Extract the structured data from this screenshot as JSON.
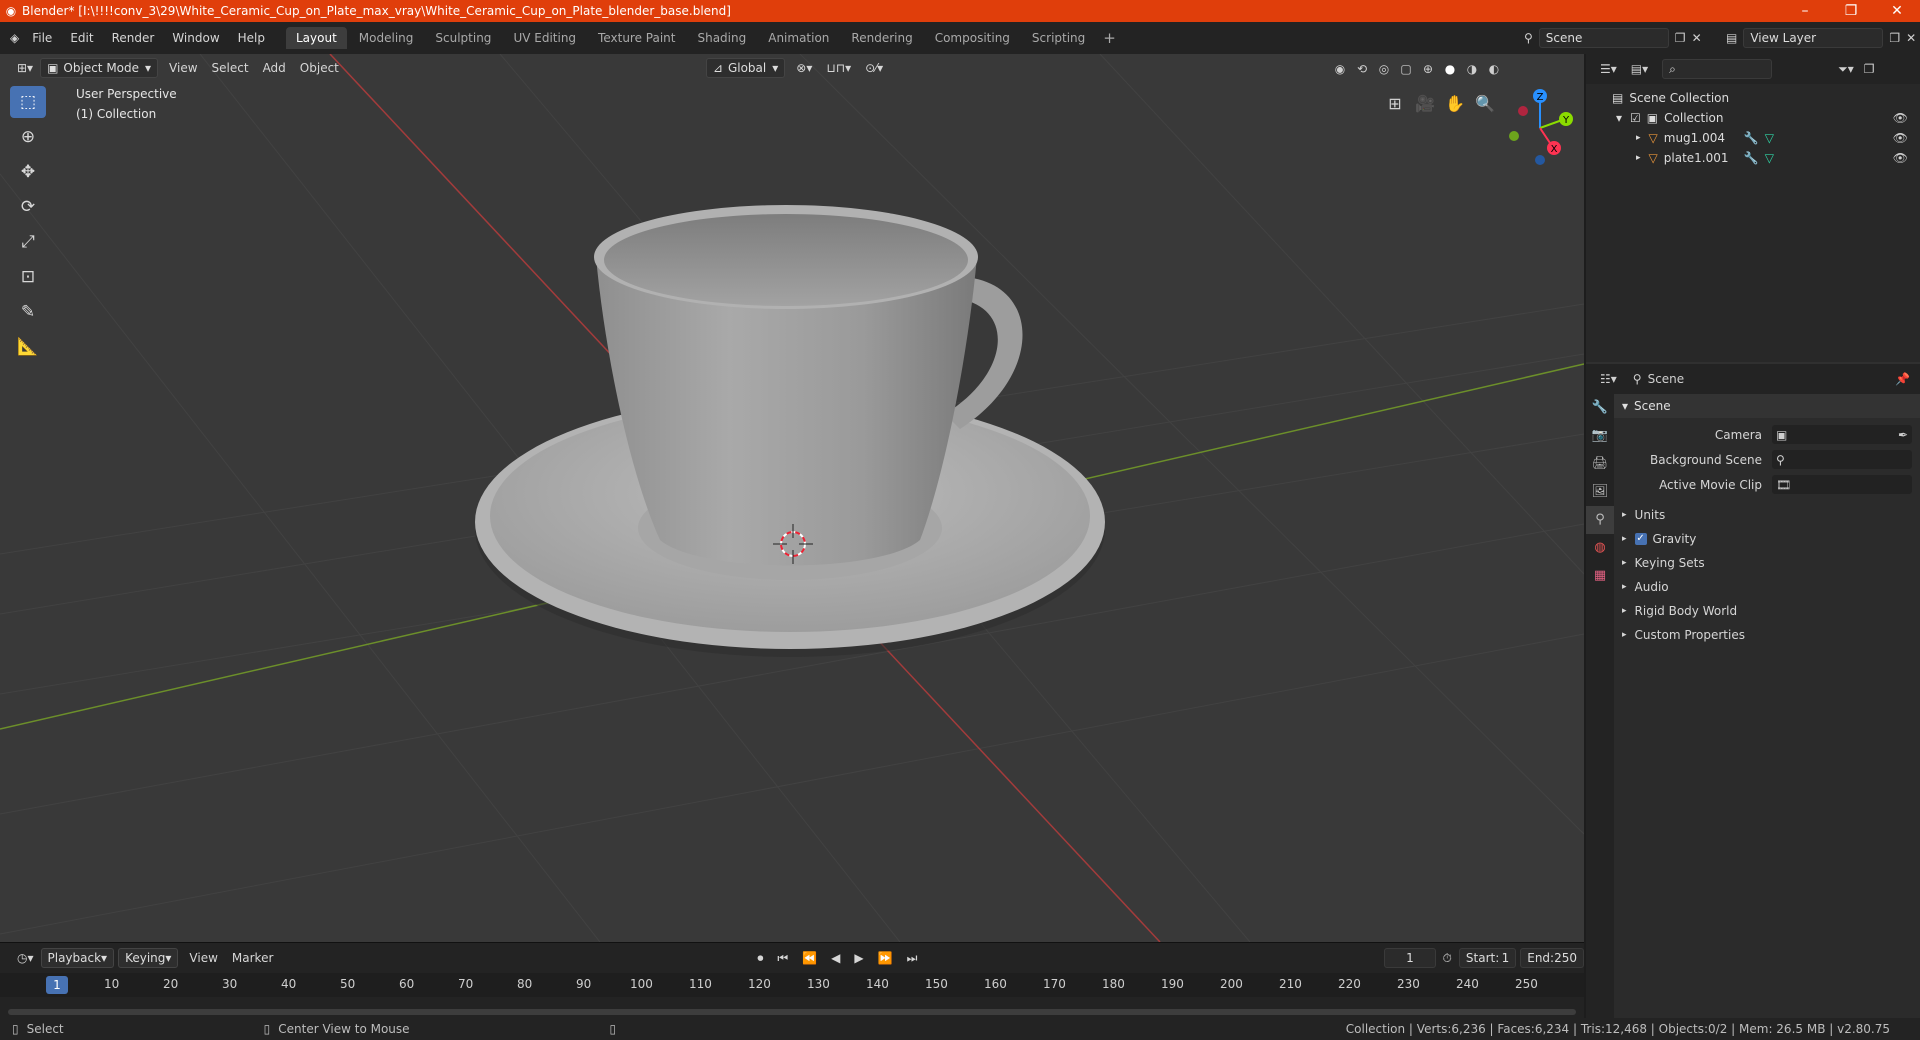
{
  "title": "Blender* [I:\\!!!!conv_3\\29\\White_Ceramic_Cup_on_Plate_max_vray\\White_Ceramic_Cup_on_Plate_blender_base.blend]",
  "menu": [
    "File",
    "Edit",
    "Render",
    "Window",
    "Help"
  ],
  "workspaces": [
    "Layout",
    "Modeling",
    "Sculpting",
    "UV Editing",
    "Texture Paint",
    "Shading",
    "Animation",
    "Rendering",
    "Compositing",
    "Scripting"
  ],
  "active_workspace": "Layout",
  "scene": "Scene",
  "view_layer": "View Layer",
  "viewport": {
    "mode": "Object Mode",
    "menus": [
      "View",
      "Select",
      "Add",
      "Object"
    ],
    "orientation": "Global",
    "info_line1": "User Perspective",
    "info_line2": "(1) Collection",
    "axes": {
      "x": "X",
      "y": "Y",
      "z": "Z"
    }
  },
  "timeline": {
    "menus": [
      "Playback",
      "Keying",
      "View",
      "Marker"
    ],
    "current_frame": "1",
    "start_label": "Start:",
    "start": "1",
    "end_label": "End:",
    "end": "250",
    "ticks": [
      "10",
      "20",
      "30",
      "40",
      "50",
      "60",
      "70",
      "80",
      "90",
      "100",
      "110",
      "120",
      "130",
      "140",
      "150",
      "160",
      "170",
      "180",
      "190",
      "200",
      "210",
      "220",
      "230",
      "240",
      "250"
    ]
  },
  "outliner": {
    "root": "Scene Collection",
    "collection": "Collection",
    "objects": [
      "mug1.004",
      "plate1.001"
    ]
  },
  "properties": {
    "header": "Scene",
    "panel": "Scene",
    "rows": [
      {
        "label": "Camera"
      },
      {
        "label": "Background Scene"
      },
      {
        "label": "Active Movie Clip"
      }
    ],
    "sections": [
      "Units",
      "Gravity",
      "Keying Sets",
      "Audio",
      "Rigid Body World",
      "Custom Properties"
    ]
  },
  "status": {
    "select": "Select",
    "center_view": "Center View to Mouse",
    "stats": "Collection | Verts:6,236 | Faces:6,234 | Tris:12,468 | Objects:0/2 | Mem: 26.5 MB | v2.80.75"
  },
  "colors": {
    "accent": "#4772b3",
    "titlebar": "#e03e0b",
    "x_axis": "#ff3352",
    "y_axis": "#8bdc00",
    "z_axis": "#2890ff"
  }
}
